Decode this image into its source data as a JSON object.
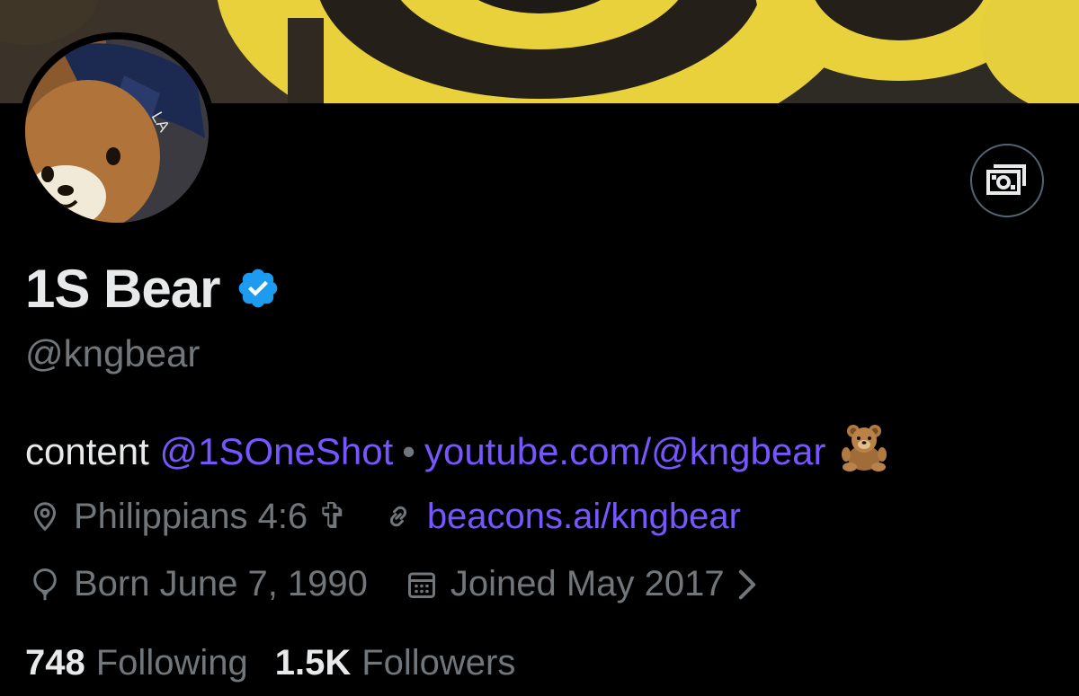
{
  "profile": {
    "display_name": "1S Bear",
    "handle": "@kngbear",
    "verified": true,
    "bio": {
      "prefix": "content",
      "mention": "@1SOneShot",
      "separator": "•",
      "link": "youtube.com/@kngbear",
      "emoji": "teddy-bear"
    },
    "location": "Philippians 4:6 ✞",
    "website": "beacons.ai/kngbear",
    "birthday": "Born June 7, 1990",
    "joined": "Joined May 2017",
    "following_count": "748",
    "following_label": "Following",
    "followers_count": "1.5K",
    "followers_label": "Followers"
  },
  "icons": {
    "location": "location-pin-icon",
    "website": "link-icon",
    "birthday": "balloon-icon",
    "joined": "calendar-icon",
    "subscribe": "money-icon",
    "verified": "verified-badge-icon"
  },
  "colors": {
    "background": "#000000",
    "text": "#e7e9ea",
    "muted": "#71767b",
    "link": "#7856ff",
    "verified": "#1d9bf0",
    "banner_yellow": "#e8d13a"
  }
}
